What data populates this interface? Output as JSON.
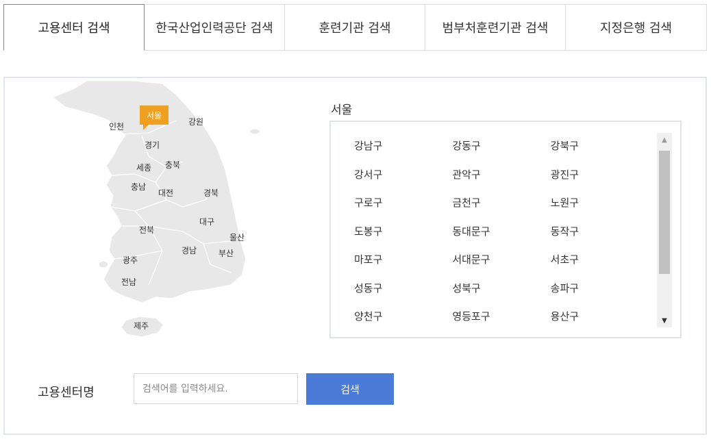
{
  "tabs": [
    {
      "label": "고용센터 검색",
      "active": true
    },
    {
      "label": "한국산업인력공단 검색",
      "active": false
    },
    {
      "label": "훈련기관 검색",
      "active": false
    },
    {
      "label": "범부처훈련기관 검색",
      "active": false
    },
    {
      "label": "지정은행 검색",
      "active": false
    }
  ],
  "map": {
    "selected": "서울",
    "labels": {
      "seoul": "서울",
      "incheon": "인천",
      "gangwon": "강원",
      "gyeonggi": "경기",
      "sejong": "세종",
      "chungbuk": "충북",
      "chungnam": "충남",
      "daejeon": "대전",
      "gyeongbuk": "경북",
      "daegu": "대구",
      "jeonbuk": "전북",
      "ulsan": "울산",
      "gyeongnam": "경남",
      "busan": "부산",
      "gwangju": "광주",
      "jeonnam": "전남",
      "jeju": "제주"
    },
    "marker_color": "#f0a020"
  },
  "district_list": {
    "title": "서울",
    "rows": [
      [
        "강남구",
        "강동구",
        "강북구"
      ],
      [
        "강서구",
        "관악구",
        "광진구"
      ],
      [
        "구로구",
        "금천구",
        "노원구"
      ],
      [
        "도봉구",
        "동대문구",
        "동작구"
      ],
      [
        "마포구",
        "서대문구",
        "서초구"
      ],
      [
        "성동구",
        "성북구",
        "송파구"
      ],
      [
        "양천구",
        "영등포구",
        "용산구"
      ]
    ]
  },
  "search": {
    "label": "고용센터명",
    "placeholder": "검색어를 입력하세요.",
    "button_label": "검색",
    "button_color": "#4a7bd9"
  }
}
